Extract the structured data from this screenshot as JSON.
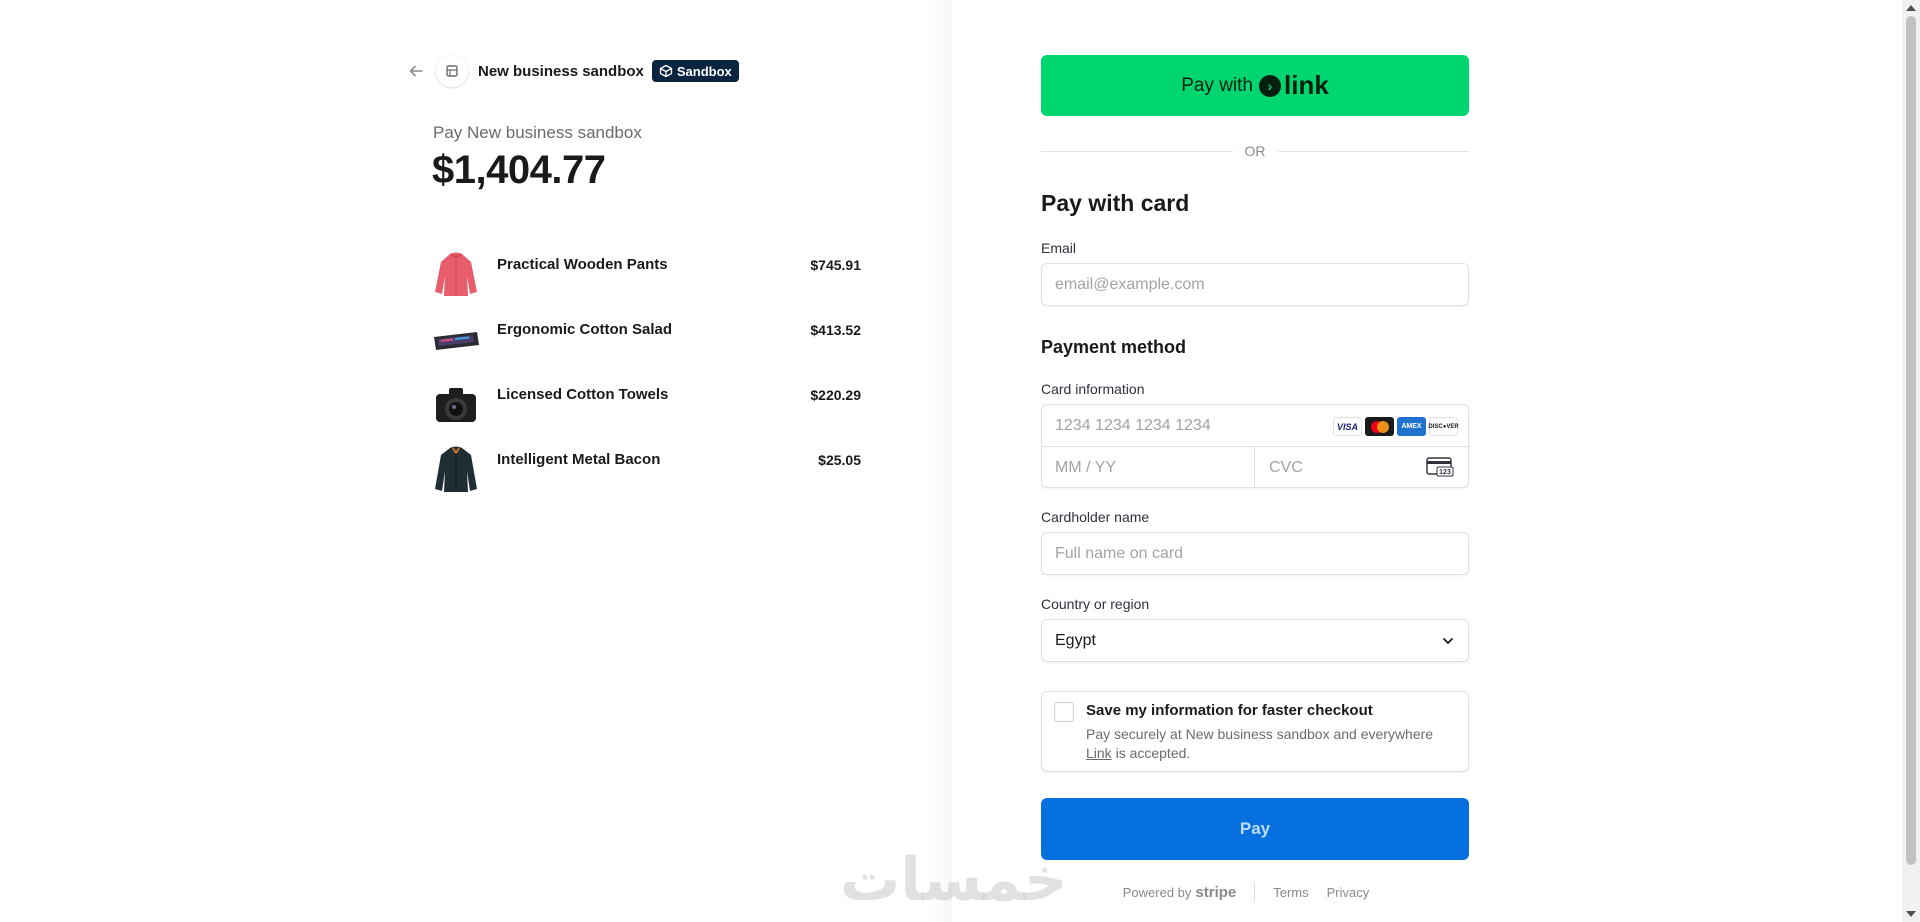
{
  "merchant": {
    "name": "New business sandbox",
    "badge": "Sandbox",
    "pay_label": "Pay New business sandbox",
    "total": "$1,404.77"
  },
  "line_items": [
    {
      "name": "Practical Wooden Pants",
      "price": "$745.91",
      "image": "jacket-pink"
    },
    {
      "name": "Ergonomic Cotton Salad",
      "price": "$413.52",
      "image": "keyboard"
    },
    {
      "name": "Licensed Cotton Towels",
      "price": "$220.29",
      "image": "camera"
    },
    {
      "name": "Intelligent Metal Bacon",
      "price": "$25.05",
      "image": "jacket-dark"
    }
  ],
  "link_button": {
    "prefix": "Pay with",
    "brand": "link"
  },
  "divider": "OR",
  "card_section": {
    "title": "Pay with card",
    "email_label": "Email",
    "email_placeholder": "email@example.com",
    "payment_method_title": "Payment method",
    "card_info_label": "Card information",
    "card_number_placeholder": "1234 1234 1234 1234",
    "expiry_placeholder": "MM / YY",
    "cvc_placeholder": "CVC",
    "cvc_icon_text": "123",
    "brands": [
      "VISA",
      "mastercard",
      "amex",
      "DISCOVER"
    ],
    "cardholder_label": "Cardholder name",
    "cardholder_placeholder": "Full name on card",
    "country_label": "Country or region",
    "country_value": "Egypt"
  },
  "save_info": {
    "title": "Save my information for faster checkout",
    "desc_prefix": "Pay securely at New business sandbox and everywhere",
    "desc_link": "Link",
    "desc_suffix": "is accepted."
  },
  "pay_button": "Pay",
  "footer": {
    "powered_by": "Powered by",
    "stripe": "stripe",
    "terms": "Terms",
    "privacy": "Privacy"
  },
  "watermark": "خمسات",
  "colors": {
    "link_green": "#00d66f",
    "pay_blue": "#0570de",
    "badge_navy": "#0a2540"
  }
}
